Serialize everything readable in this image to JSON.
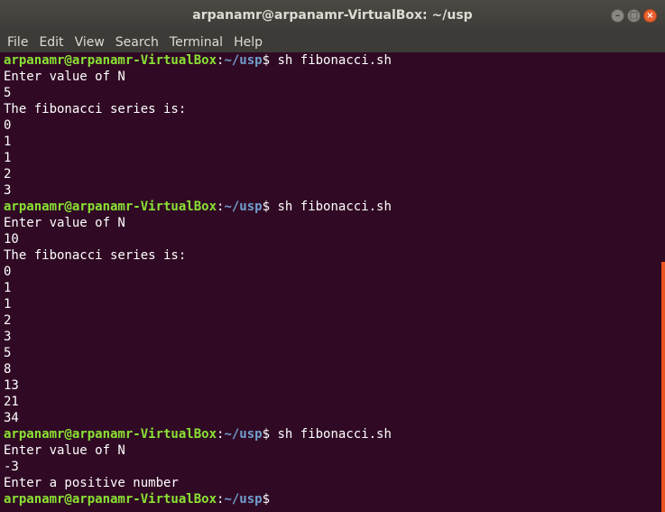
{
  "window": {
    "title": "arpanamr@arpanamr-VirtualBox: ~/usp",
    "controls": [
      "minimize",
      "maximize",
      "close"
    ]
  },
  "menu": [
    "File",
    "Edit",
    "View",
    "Search",
    "Terminal",
    "Help"
  ],
  "prompt": {
    "user_host": "arpanamr@arpanamr-VirtualBox",
    "sep": ":",
    "path": "~/usp",
    "symbol": "$"
  },
  "lines": [
    {
      "type": "prompt",
      "cmd": " sh fibonacci.sh"
    },
    {
      "type": "out",
      "text": "Enter value of N"
    },
    {
      "type": "out",
      "text": "5"
    },
    {
      "type": "out",
      "text": "The fibonacci series is:"
    },
    {
      "type": "out",
      "text": "0"
    },
    {
      "type": "out",
      "text": "1"
    },
    {
      "type": "out",
      "text": "1"
    },
    {
      "type": "out",
      "text": "2"
    },
    {
      "type": "out",
      "text": "3"
    },
    {
      "type": "prompt",
      "cmd": " sh fibonacci.sh"
    },
    {
      "type": "out",
      "text": "Enter value of N"
    },
    {
      "type": "out",
      "text": "10"
    },
    {
      "type": "out",
      "text": "The fibonacci series is:"
    },
    {
      "type": "out",
      "text": "0"
    },
    {
      "type": "out",
      "text": "1"
    },
    {
      "type": "out",
      "text": "1"
    },
    {
      "type": "out",
      "text": "2"
    },
    {
      "type": "out",
      "text": "3"
    },
    {
      "type": "out",
      "text": "5"
    },
    {
      "type": "out",
      "text": "8"
    },
    {
      "type": "out",
      "text": "13"
    },
    {
      "type": "out",
      "text": "21"
    },
    {
      "type": "out",
      "text": "34"
    },
    {
      "type": "prompt",
      "cmd": " sh fibonacci.sh"
    },
    {
      "type": "out",
      "text": "Enter value of N"
    },
    {
      "type": "out",
      "text": "-3"
    },
    {
      "type": "out",
      "text": "Enter a positive number"
    },
    {
      "type": "prompt",
      "cmd": ""
    }
  ],
  "colors": {
    "background": "#300a24",
    "user": "#8ae234",
    "path": "#729fcf",
    "scrollbar": "#e95420"
  }
}
